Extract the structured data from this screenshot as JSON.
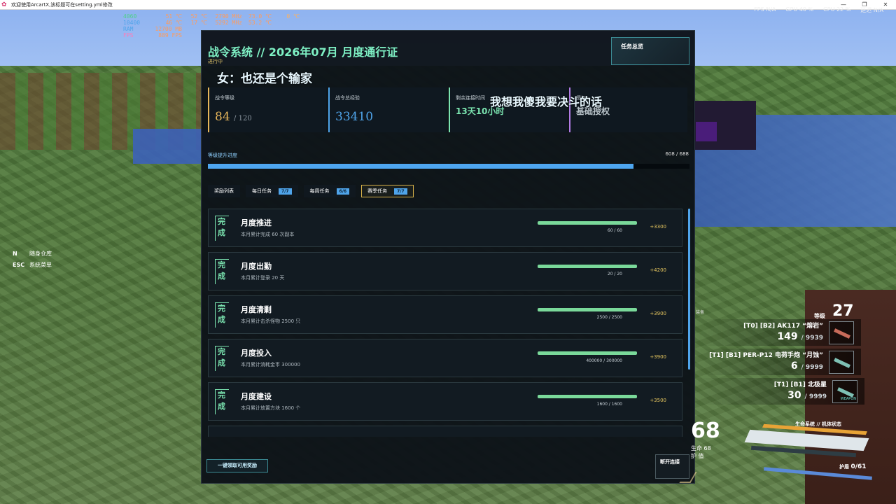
{
  "os_window": {
    "title": "欢迎使用ArcartX,该标题可在setting.yml修改",
    "minimize": "—",
    "maximize": "❐",
    "close": "✕"
  },
  "perf_stats": [
    {
      "label": "4060",
      "label_color": "#4fd08a",
      "cols": [
        "51 ℃",
        "52 ℃",
        "2790 MHz",
        "73.0 ℃",
        "0 ℃"
      ]
    },
    {
      "label": "10400",
      "label_color": "#4fa4ea",
      "cols": [
        "46 ℃",
        "17 ℃",
        "5292 MHz",
        "53.2 ℃",
        ""
      ]
    },
    {
      "label": "RAM",
      "label_color": "#4fa4ea",
      "cols": [
        "12700 MB",
        "",
        "",
        "",
        ""
      ]
    },
    {
      "label": "FPS",
      "label_color": "#ff7ab8",
      "cols": [
        "889 FPS",
        "",
        "",
        "",
        ""
      ]
    }
  ],
  "perf_right": [
    "FPS N/A",
    "GPU 40 %",
    "CPU 22 %",
    "延迟 N/A"
  ],
  "key_hints": [
    {
      "key": "N",
      "action": "随身仓库"
    },
    {
      "key": "ESC",
      "action": "系统菜单"
    }
  ],
  "panel": {
    "title": "战令系统 // 2026年07月 月度通行证",
    "status": "进行中",
    "overview_button": "任务总览",
    "subtitle_caption": "女：也还是个输家",
    "overlay_caption": "我想我傻我要决斗的话",
    "stats": [
      {
        "label": "战令等级",
        "value": "84",
        "max": "/ 120",
        "color": "#e7b65a"
      },
      {
        "label": "战令总经验",
        "value": "33410",
        "max": "",
        "color": "#4fa4ea"
      },
      {
        "label": "剩余连接时间",
        "value": "13天10小时",
        "max": "",
        "color": "#7be4b0"
      },
      {
        "label": "授权",
        "value": "基础授权",
        "max": "",
        "color": "#b07be4"
      }
    ],
    "progress": {
      "label": "等级提升进度",
      "current": 608,
      "total": 688,
      "count_text": "608 / 688"
    },
    "tabs": [
      {
        "label": "奖励列表",
        "badge": ""
      },
      {
        "label": "每日任务",
        "badge": "7/7"
      },
      {
        "label": "每周任务",
        "badge": "6/6"
      },
      {
        "label": "赛季任务",
        "badge": "7/7"
      }
    ],
    "active_tab": 3,
    "tasks": [
      {
        "done": "完成",
        "name": "月度推进",
        "desc": "本月累计完成 60 次副本",
        "progress": "60 / 60",
        "reward": "+3300"
      },
      {
        "done": "完成",
        "name": "月度出勤",
        "desc": "本月累计登录 20 天",
        "progress": "20 / 20",
        "reward": "+4200"
      },
      {
        "done": "完成",
        "name": "月度清剿",
        "desc": "本月累计击杀怪物 2500 只",
        "progress": "2500 / 2500",
        "reward": "+3900"
      },
      {
        "done": "完成",
        "name": "月度投入",
        "desc": "本月累计消耗金币 300000",
        "progress": "400000 / 300000",
        "reward": "+3900"
      },
      {
        "done": "完成",
        "name": "月度建设",
        "desc": "本月累计放置方块 1600 个",
        "progress": "1600 / 1600",
        "reward": "+3500"
      },
      {
        "done": "",
        "name": "",
        "desc": "",
        "progress": "",
        "reward": ""
      }
    ],
    "claim_button": "一键领取可用奖励",
    "disconnect_button": "断开连接"
  },
  "hud": {
    "level_label": "等级",
    "level": "27",
    "slot_title": "装备",
    "weapons": [
      {
        "name": "[T0] [B2] AK117 “熔岩”",
        "ammo": "149",
        "reserve": "/ 9939",
        "icon": "rifle-icon",
        "tag": ""
      },
      {
        "name": "[T1] [B1] PER-P12 电荷手炮 “月蚀”",
        "ammo": "6",
        "reserve": "/ 9999",
        "icon": "pistol-icon",
        "tag": ""
      },
      {
        "name": "[T1] [B1] 北极星",
        "ammo": "30",
        "reserve": "/ 9999",
        "icon": "sniper-icon",
        "tag": "WEAPON"
      }
    ],
    "big_number": "68",
    "big_number_sub": [
      "生命 68",
      "护 值"
    ],
    "health_label": "生命系统 // 机体状态",
    "armor_label": "护盾",
    "armor_value": "0/61"
  },
  "colors": {
    "accent_teal": "#7ef0c4",
    "accent_blue": "#4fa4ea",
    "accent_gold": "#e7c75f"
  }
}
